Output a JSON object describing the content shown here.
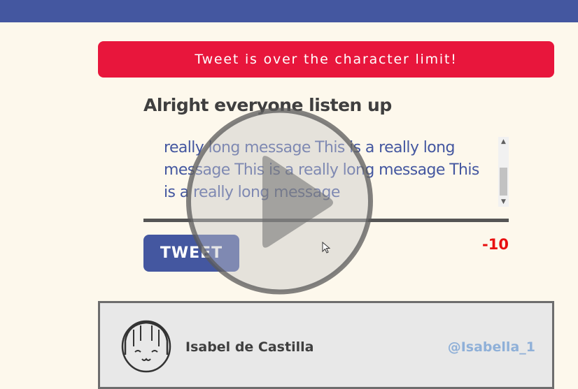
{
  "alert": {
    "message": "Tweet is over the character limit!"
  },
  "compose": {
    "title": "Alright everyone listen up",
    "textarea_value": "really long message This is a really long message This is a really long message This is a really long message",
    "tweet_label": "TWEET",
    "char_count": "-10"
  },
  "tweet_card": {
    "author_name": "Isabel de Castilla",
    "author_handle": "@Isabella_1"
  },
  "colors": {
    "brand": "#4457a0",
    "alert": "#e8163c",
    "background": "#fdf8ec",
    "count_negative": "#e81010",
    "handle": "#8fb0d8"
  },
  "icons": {
    "play": "play-icon",
    "cursor": "cursor-icon",
    "avatar": "avatar-icon"
  }
}
